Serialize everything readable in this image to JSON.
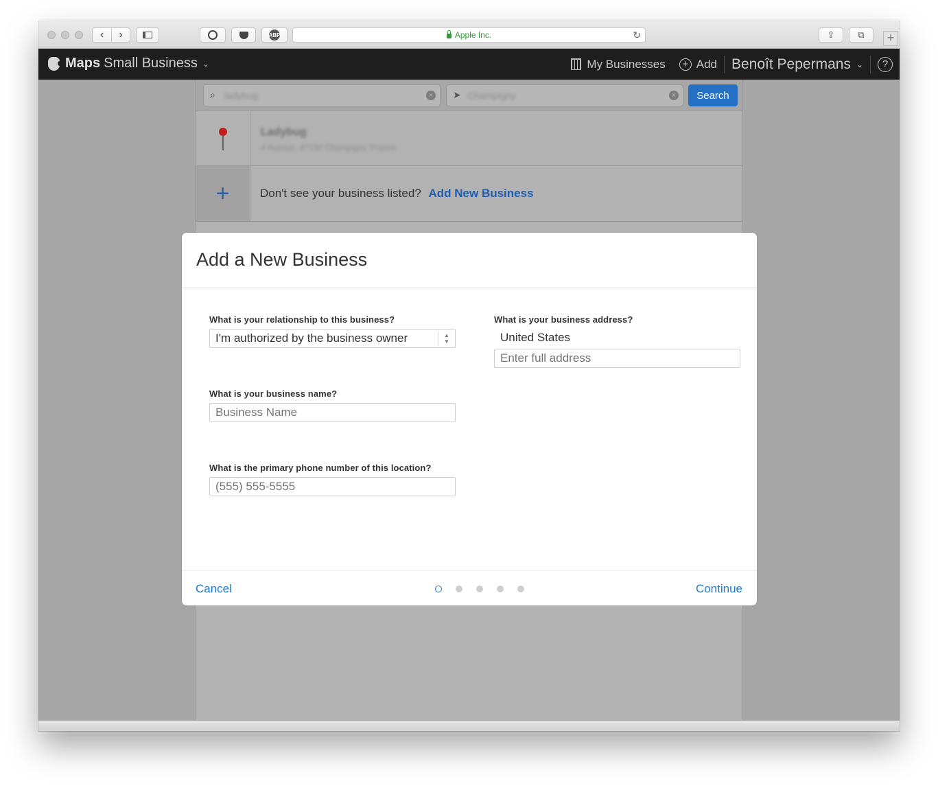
{
  "browser": {
    "address": "Apple Inc.",
    "ext_abp": "ABP",
    "new_tab": "+",
    "reload": "↻",
    "share": "⇪",
    "tabs": "⧉",
    "back": "‹",
    "forward": "›"
  },
  "app": {
    "brand_bold": "Maps",
    "brand_light": "Small Business",
    "nav": {
      "my_businesses": "My Businesses",
      "add": "Add",
      "user": "Benoît Pepermans",
      "help": "?"
    }
  },
  "background": {
    "search_button": "Search",
    "search_query": "ladybug",
    "location_query": "Champigny",
    "result_name": "Ladybug",
    "result_address": "4 Avenue, 47130 Champigny, France",
    "prompt": "Don't see your business listed?",
    "add_link": "Add New Business"
  },
  "modal": {
    "title": "Add a New Business",
    "relationship_label": "What is your relationship to this business?",
    "relationship_value": "I'm authorized by the business owner",
    "name_label": "What is your business name?",
    "name_placeholder": "Business Name",
    "phone_label": "What is the primary phone number of this location?",
    "phone_placeholder": "(555) 555-5555",
    "address_label": "What is your business address?",
    "country": "United States",
    "address_placeholder": "Enter full address",
    "cancel": "Cancel",
    "continue": "Continue",
    "steps_total": 5,
    "current_step": 1
  },
  "colors": {
    "accent": "#1e7ad1",
    "search_button": "#2370c5",
    "header": "#1e1e1e",
    "secure": "#2d9b3a"
  }
}
